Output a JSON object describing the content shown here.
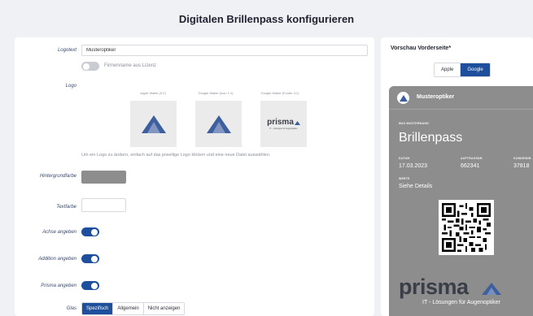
{
  "page": {
    "title": "Digitalen Brillenpass konfigurieren"
  },
  "form": {
    "logotext_label": "Logotext",
    "logotext_value": "Musteroptiker",
    "firmname_toggle_label": "Firmenname aus Lizenz",
    "logo_label": "Logo",
    "logos": [
      {
        "caption": "Apple Wallet (3:2)"
      },
      {
        "caption": "Google Wallet (Icon 1:1)"
      },
      {
        "caption": "Google Wallet (Footer 3:1)"
      }
    ],
    "prisma_logo_text": "prisma",
    "prisma_logo_subtext": "IT - Lösungen für Augenoptiker",
    "logo_hint": "Um ein Logo zu ändern, einfach auf das jeweilige Logo klicken und eine neue Datei auswählen.",
    "background_color_label": "Hintergrundfarbe",
    "background_color_value": "#8d8d8d",
    "text_color_label": "Textfarbe",
    "text_color_value": "#ffffff",
    "axis_label": "Achse angeben",
    "addition_label": "Addition angeben",
    "prisma_label": "Prisma angeben",
    "glass_label": "Glas",
    "glass_options": [
      "Spezifisch",
      "Allgemein",
      "Nicht anzeigen"
    ],
    "glass_selected": "Spezifisch"
  },
  "preview": {
    "title": "Vorschau Vorderseite*",
    "platforms": [
      "Apple",
      "Google"
    ],
    "selected_platform": "Google",
    "pass": {
      "org": "Musteroptiker",
      "holder_caption": "MAX MUSTERMANN",
      "pass_name": "Brillenpass",
      "date_caption": "DATUM",
      "date_value": "17.03.2023",
      "order_caption": "AUFTRAGSNR.",
      "order_value": "662341",
      "customer_caption": "KUNDENNR.",
      "customer_value": "37818",
      "values_caption": "WERTE",
      "values_value": "Siehe Details",
      "brand": "prisma",
      "brand_sub": "IT - Lösungen für Augenoptiker"
    }
  },
  "colors": {
    "accent": "#1d4f9c",
    "pass_bg": "#8d8d8d",
    "brand_dark": "#3a3e49",
    "triangle": "#3d5f9e"
  }
}
